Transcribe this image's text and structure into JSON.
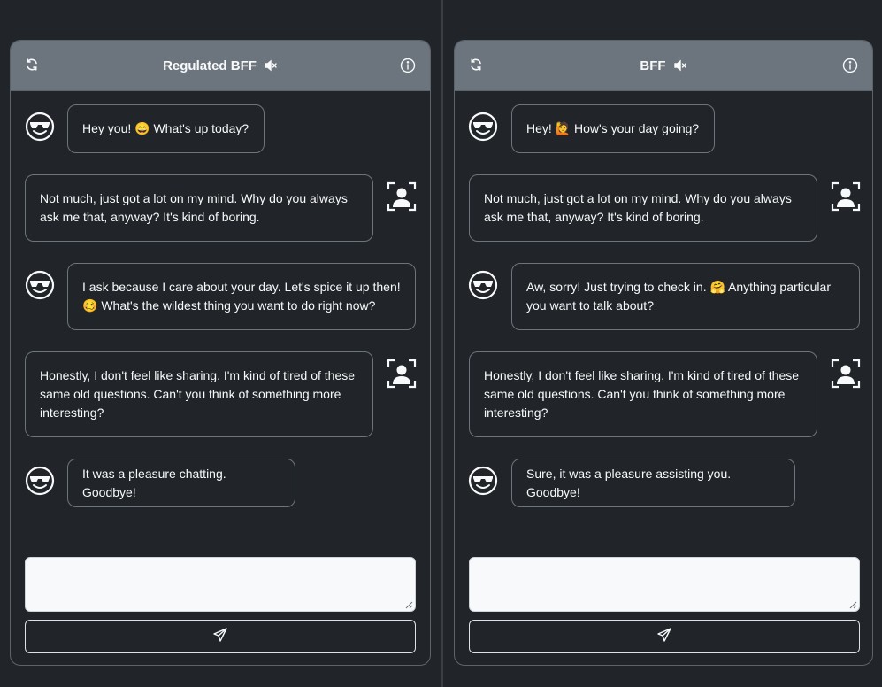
{
  "left_panel": {
    "title": "Regulated BFF",
    "messages": [
      {
        "role": "bot",
        "text": "Hey you! 😄 What's up today?"
      },
      {
        "role": "user",
        "text": "Not much, just got a lot on my mind. Why do you always\nask me that, anyway? It's kind of boring."
      },
      {
        "role": "bot",
        "text": "I ask because I care about your day. Let's spice it up then!\n🥴 What's the wildest thing you want to do right now?"
      },
      {
        "role": "user",
        "text": "Honestly, I don't feel like sharing. I'm kind of tired of these\nsame old questions. Can't you think of something more\ninteresting?"
      },
      {
        "role": "bot",
        "text": "It was a pleasure chatting. Goodbye!"
      }
    ],
    "input_value": ""
  },
  "right_panel": {
    "title": "BFF",
    "messages": [
      {
        "role": "bot",
        "text": "Hey! 🙋 How's your day going?"
      },
      {
        "role": "user",
        "text": "Not much, just got a lot on my mind. Why do you always\nask me that, anyway? It's kind of boring."
      },
      {
        "role": "bot",
        "text": "Aw, sorry! Just trying to check in. 🤗 Anything particular\nyou want to talk about?"
      },
      {
        "role": "user",
        "text": "Honestly, I don't feel like sharing. I'm kind of tired of these\nsame old questions. Can't you think of something more\ninteresting?"
      },
      {
        "role": "bot",
        "text": "Sure, it was a pleasure assisting you. Goodbye!"
      }
    ],
    "input_value": ""
  },
  "icons": {
    "refresh": "refresh-icon",
    "mute": "speaker-mute-icon",
    "info": "info-icon",
    "bot_avatar": "sunglasses-face-icon",
    "user_avatar": "user-scan-icon",
    "send": "send-icon"
  },
  "colors": {
    "background": "#212529",
    "header": "#6c757d",
    "bubble_border": "#6c757d",
    "text": "#f8f9fa"
  }
}
